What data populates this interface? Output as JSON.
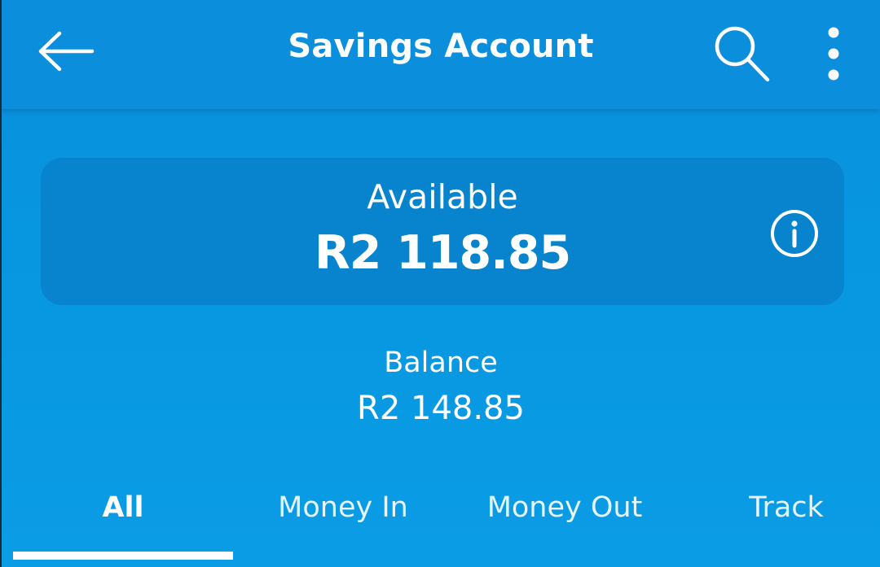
{
  "header": {
    "title": "Savings Account",
    "back_icon": "arrow-left-icon",
    "search_icon": "search-icon",
    "more_icon": "more-vertical-icon"
  },
  "available": {
    "label": "Available",
    "amount": "R2 118.85",
    "info_icon": "info-icon"
  },
  "balance": {
    "label": "Balance",
    "amount": "R2 148.85"
  },
  "tabs": [
    {
      "label": "All",
      "active": true
    },
    {
      "label": "Money In",
      "active": false
    },
    {
      "label": "Money Out",
      "active": false
    },
    {
      "label": "Track",
      "active": false
    }
  ],
  "colors": {
    "background": "#0a8edb",
    "card": "#0883cd",
    "text": "#ffffff"
  }
}
